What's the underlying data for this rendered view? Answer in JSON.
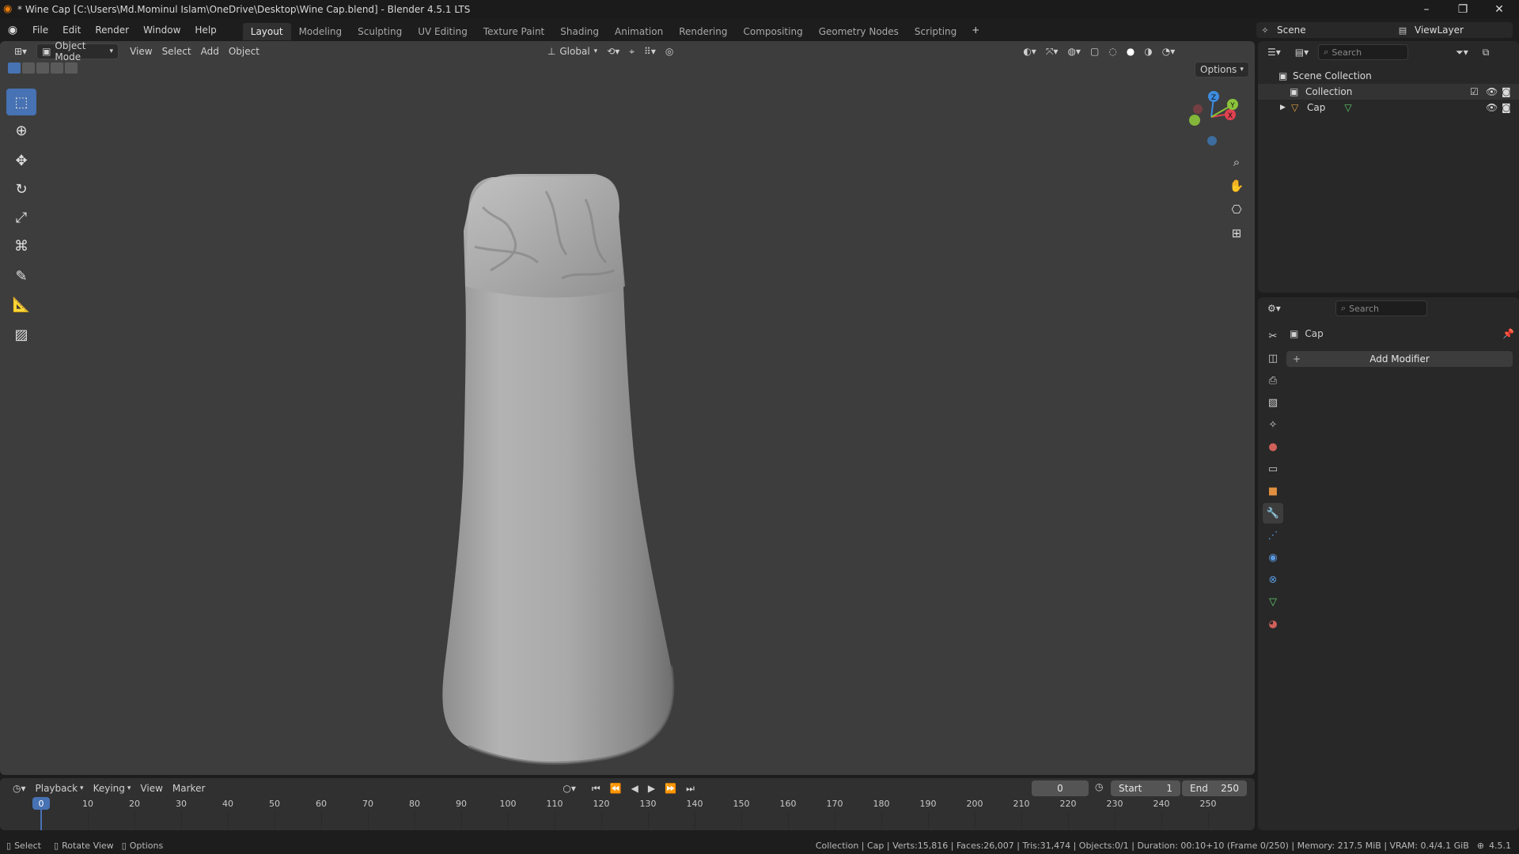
{
  "window": {
    "title": "* Wine Cap [C:\\Users\\Md.Mominul Islam\\OneDrive\\Desktop\\Wine Cap.blend] - Blender 4.5.1 LTS",
    "minimize": "–",
    "maximize": "❐",
    "close": "✕"
  },
  "menu": [
    "File",
    "Edit",
    "Render",
    "Window",
    "Help"
  ],
  "workspaces": [
    "Layout",
    "Modeling",
    "Sculpting",
    "UV Editing",
    "Texture Paint",
    "Shading",
    "Animation",
    "Rendering",
    "Compositing",
    "Geometry Nodes",
    "Scripting"
  ],
  "active_workspace": "Layout",
  "add_workspace": "+",
  "scene": {
    "label": "Scene",
    "viewlayer": "ViewLayer"
  },
  "viewport": {
    "mode": "Object Mode",
    "menus": [
      "View",
      "Select",
      "Add",
      "Object"
    ],
    "orientation": "Global",
    "options": "Options",
    "gizmo": {
      "x": "X",
      "y": "Y",
      "z": "Z"
    }
  },
  "outliner": {
    "search_placeholder": "Search",
    "scene_collection": "Scene Collection",
    "collection": "Collection",
    "object": "Cap"
  },
  "properties": {
    "search_placeholder": "Search",
    "object_name": "Cap",
    "add_modifier": "Add Modifier"
  },
  "timeline": {
    "menus": [
      "Playback",
      "Keying",
      "View",
      "Marker"
    ],
    "current_frame": "0",
    "start_label": "Start",
    "start_value": "1",
    "end_label": "End",
    "end_value": "250",
    "ticks": [
      "0",
      "10",
      "20",
      "30",
      "40",
      "50",
      "60",
      "70",
      "80",
      "90",
      "100",
      "110",
      "120",
      "130",
      "140",
      "150",
      "160",
      "170",
      "180",
      "190",
      "200",
      "210",
      "220",
      "230",
      "240",
      "250"
    ],
    "playhead": "0"
  },
  "status": {
    "select": "Select",
    "rotate": "Rotate View",
    "options": "Options",
    "info": "Collection | Cap | Verts:15,816 | Faces:26,007 | Tris:31,474 | Objects:0/1 | Duration: 00:10+10 (Frame 0/250) | Memory: 217.5 MiB | VRAM: 0.4/4.1 GiB",
    "version": "4.5.1"
  },
  "colors": {
    "accent": "#4772b3",
    "viewport_bg": "#3d3d3d",
    "axis_x": "#e0414f",
    "axis_y": "#8bc33a",
    "axis_z": "#3d8de0"
  }
}
